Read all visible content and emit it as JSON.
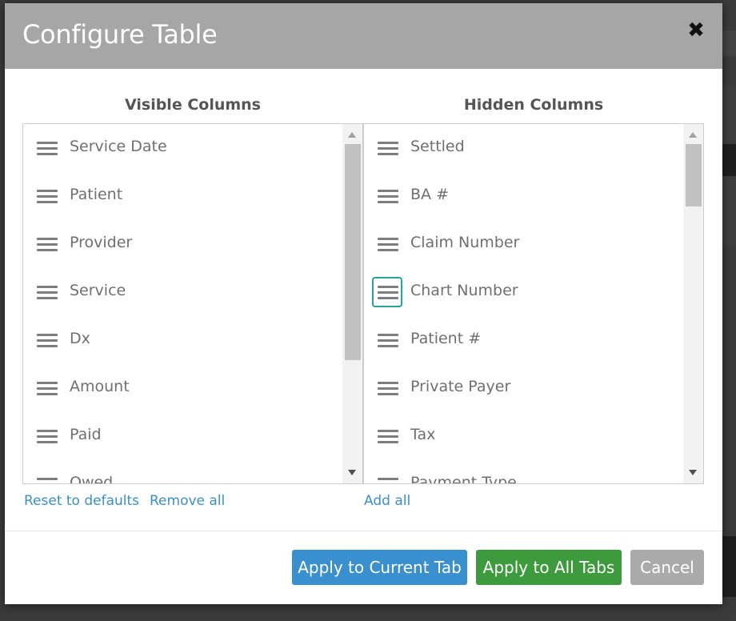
{
  "dialog": {
    "title": "Configure Table",
    "close_icon": "✖"
  },
  "visible_columns": {
    "heading": "Visible Columns",
    "items": [
      "Service Date",
      "Patient",
      "Provider",
      "Service",
      "Dx",
      "Amount",
      "Paid",
      "Owed"
    ]
  },
  "hidden_columns": {
    "heading": "Hidden Columns",
    "items": [
      "Settled",
      "BA #",
      "Claim Number",
      "Chart Number",
      "Patient #",
      "Private Payer",
      "Tax",
      "Payment Type"
    ]
  },
  "links": {
    "reset": "Reset to defaults",
    "remove_all": "Remove all",
    "add_all": "Add all"
  },
  "buttons": {
    "apply_current": "Apply to Current Tab",
    "apply_all": "Apply to All Tabs",
    "cancel": "Cancel"
  },
  "colors": {
    "apply_current": "#3a8fcf",
    "apply_all": "#3d9a3d",
    "cancel": "#aaaaaa",
    "focus": "#26a69a"
  }
}
